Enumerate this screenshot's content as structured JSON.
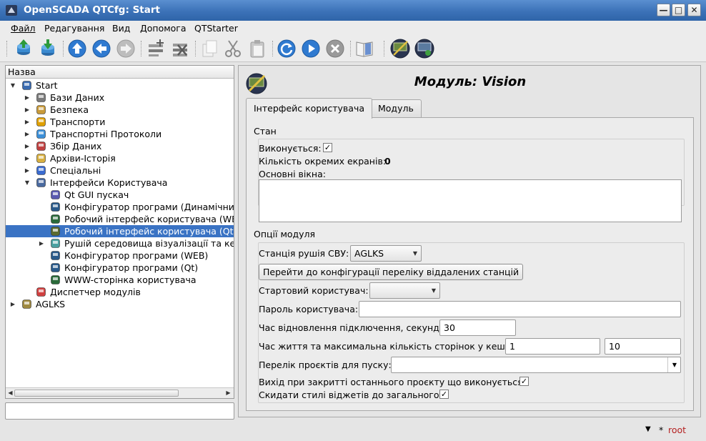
{
  "window": {
    "title": "OpenSCADA QTCfg: Start",
    "minimize_glyph": "—",
    "maximize_glyph": "□",
    "close_glyph": "✕"
  },
  "menu": [
    {
      "label": "Файл",
      "underline": "Ф"
    },
    {
      "label": "Редагування"
    },
    {
      "label": "Вид"
    },
    {
      "label": "Допомога"
    },
    {
      "label": "QTStarter"
    }
  ],
  "toolbar": [
    {
      "icon": "db-load-icon"
    },
    {
      "icon": "db-save-icon"
    },
    {
      "icon": "up-icon"
    },
    {
      "icon": "back-icon"
    },
    {
      "icon": "forward-icon"
    },
    {
      "icon": "add-item-icon"
    },
    {
      "icon": "delete-item-icon"
    },
    {
      "icon": "copy-icon"
    },
    {
      "icon": "cut-icon"
    },
    {
      "icon": "paste-icon"
    },
    {
      "icon": "refresh-icon"
    },
    {
      "icon": "start-icon"
    },
    {
      "icon": "stop-icon"
    },
    {
      "icon": "manual-icon"
    },
    {
      "icon": "vision-module-icon"
    },
    {
      "icon": "vision-runtime-icon"
    }
  ],
  "tree": {
    "header": "Назва",
    "items": [
      {
        "label": "Start",
        "level": 0,
        "arrow": "▼",
        "icon": "station-icon",
        "color": "#3a6bb0"
      },
      {
        "label": "Бази Даних",
        "level": 1,
        "arrow": "▶",
        "icon": "database-icon",
        "color": "#7a7a7a"
      },
      {
        "label": "Безпека",
        "level": 1,
        "arrow": "▶",
        "icon": "security-icon",
        "color": "#c89a3a"
      },
      {
        "label": "Транспорти",
        "level": 1,
        "arrow": "▶",
        "icon": "transport-icon",
        "color": "#e0a000"
      },
      {
        "label": "Транспортні Протоколи",
        "level": 1,
        "arrow": "▶",
        "icon": "protocol-icon",
        "color": "#3b8fd8"
      },
      {
        "label": "Збір Даних",
        "level": 1,
        "arrow": "▶",
        "icon": "data-acquisition-icon",
        "color": "#c04040"
      },
      {
        "label": "Архіви-Історія",
        "level": 1,
        "arrow": "▶",
        "icon": "archive-icon",
        "color": "#d8b040"
      },
      {
        "label": "Спеціальні",
        "level": 1,
        "arrow": "▶",
        "icon": "special-icon",
        "color": "#3a6bd0"
      },
      {
        "label": "Інтерфейси Користувача",
        "level": 1,
        "arrow": "▼",
        "icon": "ui-icon",
        "color": "#4a6aa0"
      },
      {
        "label": "Qt GUI пускач",
        "level": 2,
        "arrow": "",
        "icon": "qt-starter-icon",
        "color": "#5a5ab0"
      },
      {
        "label": "Конфігуратор програми (Динамічний",
        "level": 2,
        "arrow": "",
        "icon": "configurator-icon",
        "color": "#2a5a8a"
      },
      {
        "label": "Робочий інтерфейс користувача (WEB",
        "level": 2,
        "arrow": "",
        "icon": "web-runtime-icon",
        "color": "#2a6a3a"
      },
      {
        "label": "Робочий інтерфейс користувача (Qt)",
        "level": 2,
        "arrow": "",
        "icon": "vision-icon",
        "color": "#5a6a30",
        "selected": true
      },
      {
        "label": "Рушій середовища візуалізації та кер",
        "level": 2,
        "arrow": "▶",
        "icon": "vcs-engine-icon",
        "color": "#4aa0a0"
      },
      {
        "label": "Конфігуратор програми (WEB)",
        "level": 2,
        "arrow": "",
        "icon": "web-configurator-icon",
        "color": "#2a5a8a"
      },
      {
        "label": "Конфігуратор програми (Qt)",
        "level": 2,
        "arrow": "",
        "icon": "qt-configurator-icon",
        "color": "#2a5a8a"
      },
      {
        "label": "WWW-сторінка користувача",
        "level": 2,
        "arrow": "",
        "icon": "www-page-icon",
        "color": "#2a6a3a"
      },
      {
        "label": "Диспетчер модулів",
        "level": 1,
        "arrow": "",
        "icon": "module-manager-icon",
        "color": "#d04040"
      },
      {
        "label": "AGLKS",
        "level": 0,
        "arrow": "▶",
        "icon": "station-aglks-icon",
        "color": "#a08a40"
      }
    ]
  },
  "right": {
    "title": "Модуль: Vision",
    "tabs": [
      {
        "label": "Інтерфейс користувача",
        "active": true
      },
      {
        "label": "Модуль",
        "active": false
      }
    ],
    "state": {
      "title": "Стан",
      "running_label": "Виконується:",
      "running_checked": true,
      "screens_label": "Кількість окремих екранів:",
      "screens_value": "0",
      "main_windows_label": "Основні вікна:"
    },
    "options": {
      "title": "Опції модуля",
      "vcs_station_label": "Станція рушія СВУ:",
      "vcs_station_value": "AGLKS",
      "remote_stations_button": "Перейти до конфігурації переліку віддалених станцій",
      "start_user_label": "Стартовий користувач:",
      "start_user_value": "",
      "user_password_label": "Пароль користувача:",
      "user_password_value": "",
      "restore_time_label": "Час відновлення підключення, секунд:",
      "restore_time_value": "30",
      "cache_label": "Час життя та максимальна кількість сторінок у кеші:",
      "cache_time_value": "1",
      "cache_pages_value": "10",
      "projects_label": "Перелік проєктів для пуску:",
      "projects_value": "",
      "exit_last_label": "Вихід при закритті останнього проєкту що виконується:",
      "exit_last_checked": true,
      "drop_styles_label": "Скидати стилі віджетів до загального:",
      "drop_styles_checked": true
    }
  },
  "status": {
    "user": "root",
    "star": "*"
  },
  "colors": {
    "selection": "#3a73c4",
    "title_bar": "#3c72b8",
    "status_user": "#b42020"
  }
}
